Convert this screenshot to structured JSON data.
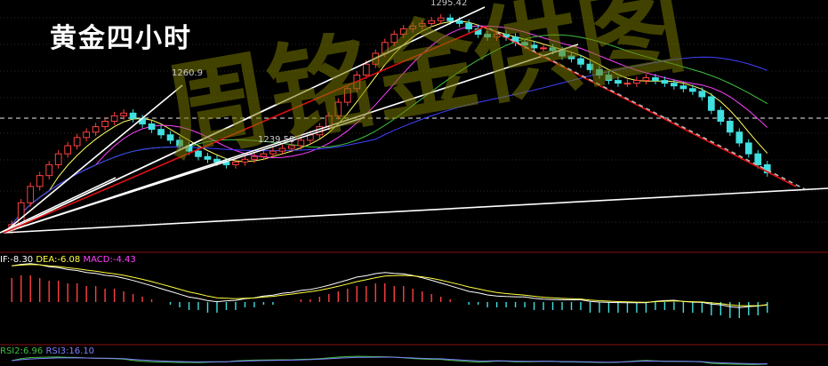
{
  "title": "黄金四小时",
  "watermark": "周铭金供图",
  "annotations": {
    "high1": "1260.9",
    "low1": "1239.58",
    "high2": "1295.42"
  },
  "indicators": {
    "dif": "IF:-8.30",
    "dea": "DEA:-6.08",
    "macd": "MACD:-4.43",
    "rsi2": "RSI2:6.96",
    "rsi3": "RSI3:16.10"
  },
  "colors": {
    "background": "#000000",
    "up": "#ff4040",
    "down": "#40e0e0",
    "ma_yellow": "#ffff60",
    "ma_magenta": "#ff40ff",
    "ma_green": "#40c040",
    "ma_blue": "#4040ff",
    "trend_red": "#e01010",
    "trend_white": "#ffffff",
    "dif_color": "#ffffff",
    "dea_color": "#ffff40",
    "macd_color": "#ff40ff",
    "rsi2_color": "#40c040",
    "rsi3_color": "#8080ff"
  },
  "chart_data": {
    "type": "candlestick",
    "title": "黄金四小时",
    "ylim": [
      1213,
      1298
    ],
    "price_close": [
      1218,
      1226,
      1232,
      1236,
      1240,
      1244,
      1247,
      1250,
      1252,
      1254,
      1256,
      1258,
      1259,
      1257,
      1255,
      1253,
      1251,
      1249,
      1247,
      1245,
      1243,
      1242,
      1241,
      1240,
      1241,
      1242,
      1243,
      1244,
      1245,
      1246,
      1247,
      1249,
      1251,
      1254,
      1258,
      1263,
      1268,
      1273,
      1277,
      1281,
      1285,
      1288,
      1290,
      1291,
      1292,
      1293,
      1294,
      1293,
      1292,
      1290,
      1288,
      1287,
      1288,
      1287,
      1285,
      1284,
      1283,
      1283,
      1282,
      1280,
      1279,
      1277,
      1275,
      1273,
      1271,
      1270,
      1270,
      1271,
      1272,
      1271,
      1270,
      1269,
      1268,
      1267,
      1265,
      1260,
      1256,
      1252,
      1248,
      1244,
      1240,
      1237
    ],
    "macd_hist": [
      9,
      10,
      10,
      9,
      8,
      8,
      7,
      7,
      6,
      6,
      5,
      5,
      4,
      3,
      2,
      1,
      0,
      -1,
      -2,
      -3,
      -3,
      -4,
      -4,
      -3,
      -3,
      -2,
      -2,
      -1,
      -1,
      0,
      0,
      1,
      1,
      2,
      3,
      4,
      5,
      6,
      6,
      7,
      7,
      6,
      6,
      5,
      4,
      3,
      2,
      1,
      0,
      -1,
      -1,
      -2,
      -2,
      -2,
      -2,
      -2,
      -3,
      -3,
      -3,
      -3,
      -3,
      -3,
      -4,
      -4,
      -4,
      -4,
      -4,
      -4,
      -4,
      -3,
      -3,
      -3,
      -4,
      -4,
      -4,
      -5,
      -5,
      -6,
      -6,
      -5,
      -5,
      -4
    ],
    "dif": -8.3,
    "dea": -6.08,
    "macd": -4.43,
    "rsi2": 6.96,
    "rsi3": 16.1,
    "labels": [
      "1260.9",
      "1239.58",
      "1295.42"
    ]
  }
}
